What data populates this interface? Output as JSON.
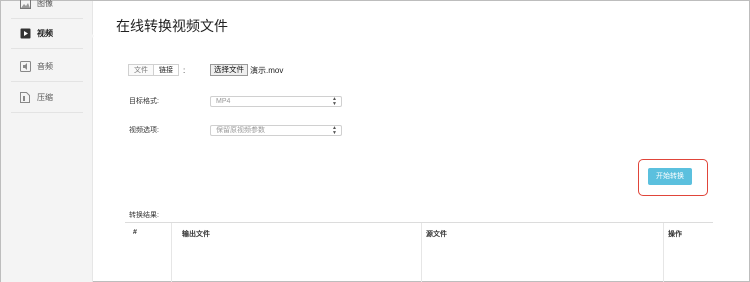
{
  "sidebar": {
    "items": [
      {
        "label": "图像",
        "icon": "image-icon"
      },
      {
        "label": "视频",
        "icon": "video-icon"
      },
      {
        "label": "音频",
        "icon": "audio-icon"
      },
      {
        "label": "压缩",
        "icon": "compress-icon"
      }
    ]
  },
  "page": {
    "title": "在线转换视频文件"
  },
  "source": {
    "tabs": [
      "文件",
      "链接"
    ],
    "colon": ":",
    "choose_button": "选择文件",
    "file_name": "演示.mov"
  },
  "form": {
    "format_label": "目标格式:",
    "format_value": "MP4",
    "options_label": "视频选项:",
    "options_value": "保留原视频参数"
  },
  "actions": {
    "start_label": "开始转换"
  },
  "results": {
    "label": "转换结果:",
    "columns": [
      "#",
      "输出文件",
      "源文件",
      "操作"
    ]
  },
  "colors": {
    "accent": "#5bc0de",
    "highlight": "#e0453a"
  }
}
